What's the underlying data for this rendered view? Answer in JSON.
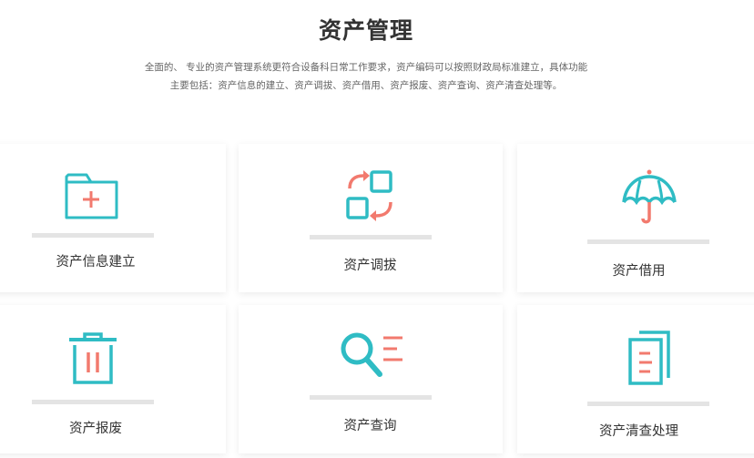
{
  "header": {
    "title": "资产管理",
    "desc_line1": "全面的、 专业的资产管理系统更符合设备科日常工作要求，资产编码可以按照财政局标准建立，具体功能",
    "desc_line2": "主要包括：资产信息的建立、资产调拔、资产借用、资产报废、资产查询、资产清查处理等。"
  },
  "colors": {
    "teal": "#2fbcc4",
    "coral": "#f27a6e",
    "bar": "#e4e4e4"
  },
  "cards": [
    {
      "label": "资产信息建立",
      "icon": "folder-add-icon"
    },
    {
      "label": "资产调拔",
      "icon": "transfer-icon"
    },
    {
      "label": "资产借用",
      "icon": "umbrella-icon"
    },
    {
      "label": "资产报废",
      "icon": "trash-icon"
    },
    {
      "label": "资产查询",
      "icon": "search-list-icon"
    },
    {
      "label": "资产清查处理",
      "icon": "documents-icon"
    }
  ]
}
